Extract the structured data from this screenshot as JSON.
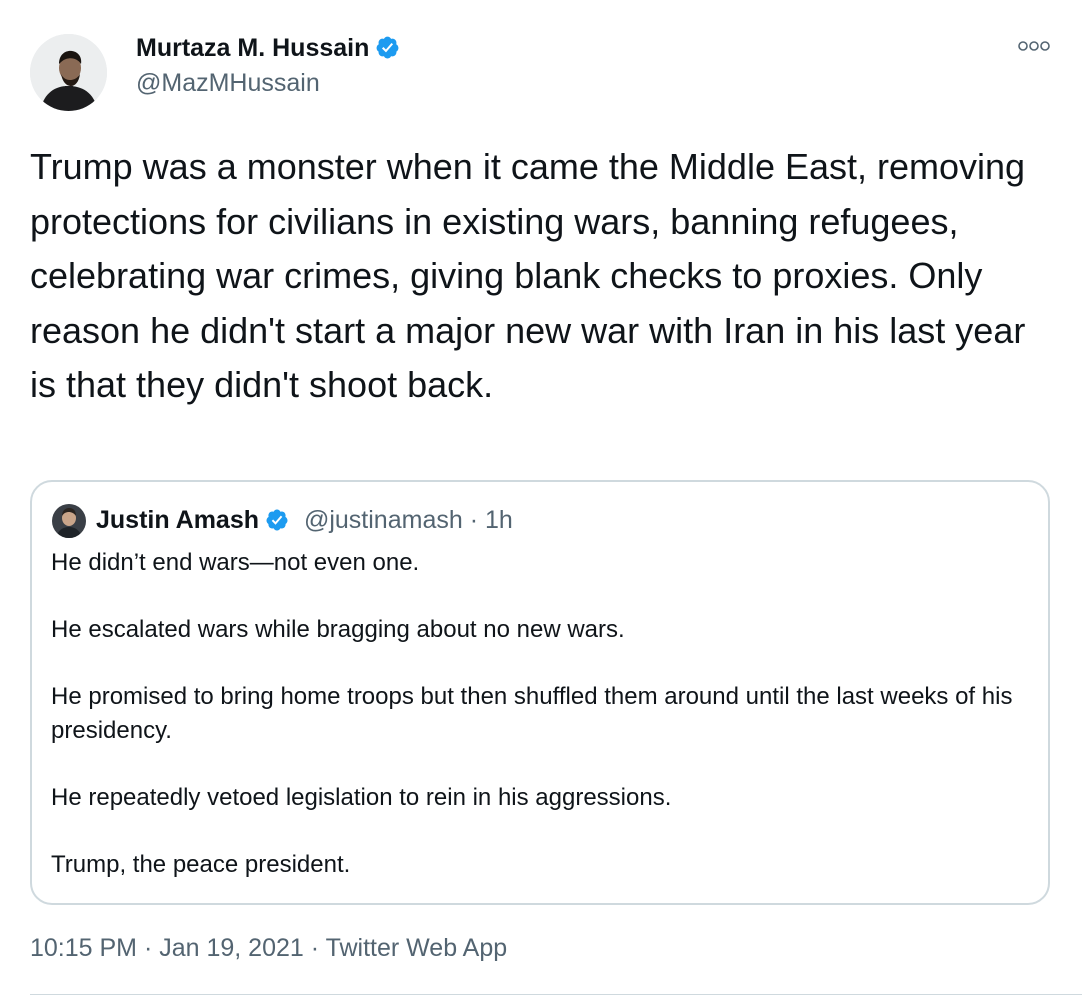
{
  "tweet": {
    "author": {
      "name": "Murtaza M. Hussain",
      "handle": "@MazMHussain",
      "verified": true,
      "avatar_icon": "profile-photo"
    },
    "more_icon": "more-options-icon",
    "text": "Trump was a monster when it came the Middle East, removing protections for civilians in existing wars, banning refugees, celebrating war crimes, giving blank checks to proxies. Only reason he didn't start a major new war with Iran in his last year is that they didn't shoot back.",
    "quote": {
      "author_name": "Justin Amash",
      "handle": "@justinamash",
      "separator": " · ",
      "time": "1h",
      "verified": true,
      "paragraphs": [
        "He didn’t end wars—not even one.",
        "He escalated wars while bragging about no new wars.",
        "He promised to bring home troops but then shuffled them around until the last weeks of his presidency.",
        "He repeatedly vetoed legislation to rein in his aggressions.",
        "Trump, the peace president."
      ]
    },
    "meta": {
      "time": "10:15 PM",
      "sep1": " · ",
      "date": "Jan 19, 2021",
      "sep2": " · ",
      "source": "Twitter Web App"
    }
  },
  "colors": {
    "text_primary": "#0f1419",
    "text_secondary": "#536471",
    "verified_blue": "#1d9bf0",
    "border": "#cfd9de"
  }
}
